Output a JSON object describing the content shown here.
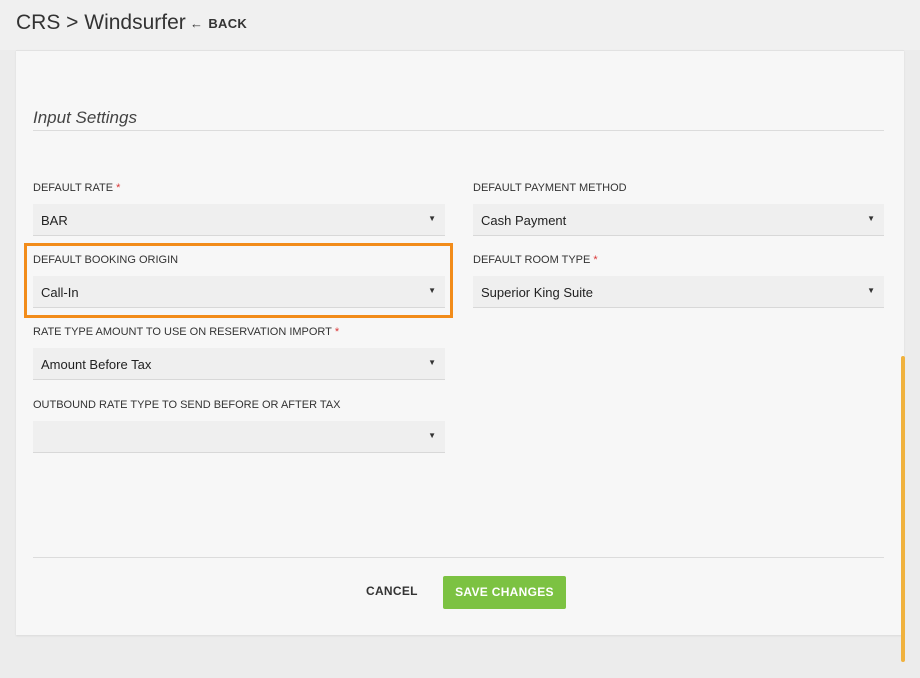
{
  "header": {
    "title": "CRS > Windsurfer",
    "back_label": "BACK"
  },
  "section": {
    "title": "Input Settings"
  },
  "fields": {
    "default_rate": {
      "label": "DEFAULT RATE",
      "required": "*",
      "value": "BAR"
    },
    "default_payment_method": {
      "label": "DEFAULT PAYMENT METHOD",
      "value": "Cash Payment"
    },
    "default_booking_origin": {
      "label": "DEFAULT BOOKING ORIGIN",
      "value": "Call-In"
    },
    "default_room_type": {
      "label": "DEFAULT ROOM TYPE",
      "required": "*",
      "value": "Superior King Suite"
    },
    "rate_type_amount": {
      "label": "RATE TYPE AMOUNT TO USE ON RESERVATION IMPORT",
      "required": "*",
      "value": "Amount Before Tax"
    },
    "outbound_rate_type": {
      "label": "OUTBOUND RATE TYPE TO SEND BEFORE OR AFTER TAX",
      "value": ""
    }
  },
  "actions": {
    "cancel_label": "CANCEL",
    "save_label": "SAVE CHANGES"
  },
  "colors": {
    "highlight": "#f28c1a",
    "save_button": "#7cc242",
    "required": "#d93636",
    "scrollbar": "#f0b23e"
  },
  "icons": {
    "back": "arrow-left-icon",
    "dropdown": "caret-down-icon"
  }
}
